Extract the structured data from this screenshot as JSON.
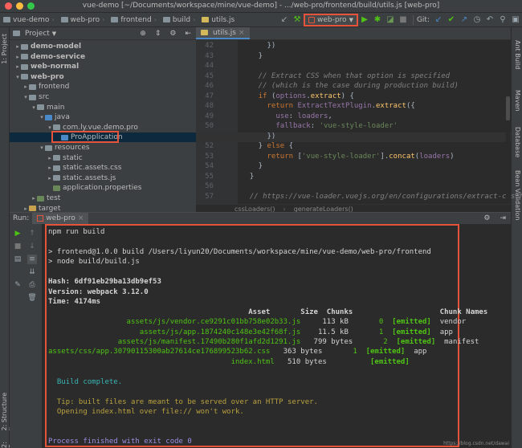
{
  "window": {
    "title": "vue-demo [~/Documents/workspace/mine/vue-demo] - .../web-pro/frontend/build/utils.js [web-pro]"
  },
  "breadcrumbs": [
    "vue-demo",
    "web-pro",
    "frontend",
    "build",
    "utils.js"
  ],
  "toolbar": {
    "run_config": "web-pro",
    "git_label": "Git:"
  },
  "project": {
    "header": "Project",
    "tree": [
      {
        "label": "demo-model",
        "indent": 0,
        "arrow": "▸",
        "bold": true,
        "color": "#87939a"
      },
      {
        "label": "demo-service",
        "indent": 0,
        "arrow": "▸",
        "bold": true,
        "color": "#87939a"
      },
      {
        "label": "web-normal",
        "indent": 0,
        "arrow": "▸",
        "bold": true,
        "color": "#87939a"
      },
      {
        "label": "web-pro",
        "indent": 0,
        "arrow": "▾",
        "bold": true,
        "color": "#87939a"
      },
      {
        "label": "frontend",
        "indent": 1,
        "arrow": "▸",
        "bold": false,
        "color": "#87939a"
      },
      {
        "label": "src",
        "indent": 1,
        "arrow": "▾",
        "bold": false,
        "color": "#87939a"
      },
      {
        "label": "main",
        "indent": 2,
        "arrow": "▾",
        "bold": false,
        "color": "#87939a"
      },
      {
        "label": "java",
        "indent": 3,
        "arrow": "▾",
        "bold": false,
        "color": "#4a88c7"
      },
      {
        "label": "com.ly.vue.demo.pro",
        "indent": 4,
        "arrow": "▾",
        "bold": false,
        "color": "#87939a"
      },
      {
        "label": "ProApplication",
        "indent": 5,
        "arrow": "",
        "bold": false,
        "color": "#4a88c7",
        "selected": true
      },
      {
        "label": "resources",
        "indent": 3,
        "arrow": "▾",
        "bold": false,
        "color": "#87939a"
      },
      {
        "label": "static",
        "indent": 4,
        "arrow": "▸",
        "bold": false,
        "color": "#87939a"
      },
      {
        "label": "static.assets.css",
        "indent": 4,
        "arrow": "▸",
        "bold": false,
        "color": "#87939a"
      },
      {
        "label": "static.assets.js",
        "indent": 4,
        "arrow": "▸",
        "bold": false,
        "color": "#87939a"
      },
      {
        "label": "application.properties",
        "indent": 4,
        "arrow": "",
        "bold": false,
        "color": "#6a8759"
      },
      {
        "label": "test",
        "indent": 2,
        "arrow": "▸",
        "bold": false,
        "color": "#6a8759"
      },
      {
        "label": "target",
        "indent": 1,
        "arrow": "▸",
        "bold": false,
        "color": "#c7a050"
      }
    ]
  },
  "editor": {
    "tab": "utils.js",
    "line_numbers": [
      "42",
      "43",
      "44",
      "45",
      "46",
      "47",
      "48",
      "49",
      "50",
      "51",
      "52",
      "53",
      "54",
      "55",
      "56",
      "57"
    ],
    "lines": [
      "      })",
      "    }",
      "",
      "    // Extract CSS when that option is specified",
      "    // (which is the case during production build)",
      "    if (options.extract) {",
      "      return ExtractTextPlugin.extract({",
      "        use: loaders,",
      "        fallback: 'vue-style-loader'",
      "      })",
      "    } else {",
      "      return ['vue-style-loader'].concat(loaders)",
      "    }",
      "  }",
      "",
      "  // https://vue-loader.vuejs.org/en/configurations/extract-css.html"
    ],
    "status_items": [
      "cssLoaders()",
      "generateLoaders()"
    ]
  },
  "run": {
    "label": "Run:",
    "tab": "web-pro",
    "console": [
      {
        "text": "npm run build",
        "cls": ""
      },
      {
        "text": "",
        "cls": ""
      },
      {
        "text": "> frontend@1.0.0 build /Users/liyun20/Documents/workspace/mine/vue-demo/web-pro/frontend",
        "cls": ""
      },
      {
        "text": "> node build/build.js",
        "cls": ""
      },
      {
        "text": "",
        "cls": ""
      },
      {
        "text": "Hash: 6df91eb29ba13db9ef53",
        "cls": "wm"
      },
      {
        "text": "Version: webpack 3.12.0",
        "cls": "wm"
      },
      {
        "text": "Time: 4174ms",
        "cls": "wm"
      },
      {
        "text": "                                              Asset       Size  Chunks                    Chunk Names",
        "cls": "wm"
      },
      {
        "text": "                  assets/js/vendor.ce9291c01bb758e02b33.js     113 kB       0  [emitted]  vendor",
        "cls": "g"
      },
      {
        "text": "                     assets/js/app.1874240c148e3e42f68f.js    11.5 kB       1  [emitted]  app",
        "cls": "g"
      },
      {
        "text": "                assets/js/manifest.17490b280f1afd2d1291.js   799 bytes       2  [emitted]  manifest",
        "cls": "g"
      },
      {
        "text": "assets/css/app.30790115300ab27614ce176899523b62.css   363 bytes       1  [emitted]  app",
        "cls": "g"
      },
      {
        "text": "                                          index.html   510 bytes          [emitted]",
        "cls": "g"
      },
      {
        "text": "",
        "cls": ""
      },
      {
        "text": "  Build complete.",
        "cls": "cyan"
      },
      {
        "text": "",
        "cls": ""
      },
      {
        "text": "  Tip: built files are meant to be served over an HTTP server.",
        "cls": "yl"
      },
      {
        "text": "  Opening index.html over file:// won't work.",
        "cls": "yl"
      },
      {
        "text": "",
        "cls": ""
      },
      {
        "text": "",
        "cls": ""
      },
      {
        "text": "Process finished with exit code 0",
        "cls": "pur"
      }
    ]
  },
  "side_tabs": {
    "left": [
      "1: Project",
      "2: Structure",
      "2: Favorites"
    ],
    "right": [
      "Ant Build",
      "Maven",
      "Database",
      "Bean Validation"
    ]
  },
  "watermark": "https://blog.csdn.net/dawai"
}
